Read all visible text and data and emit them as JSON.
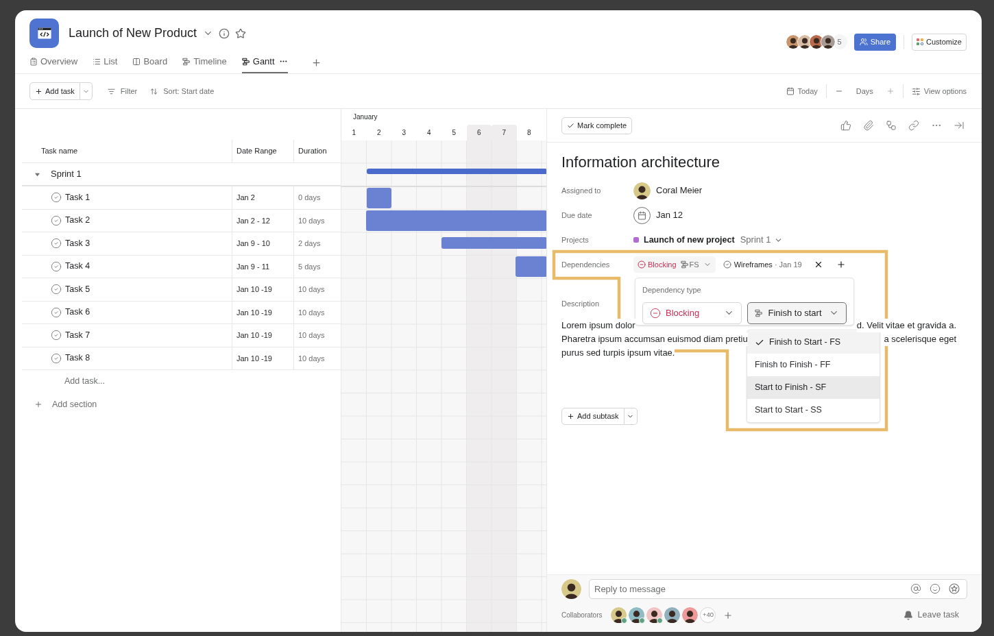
{
  "project": {
    "title": "Launch of New Product"
  },
  "tabs": [
    {
      "label": "Overview",
      "kind": "overview",
      "selected": false
    },
    {
      "label": "List",
      "kind": "list",
      "selected": false
    },
    {
      "label": "Board",
      "kind": "board",
      "selected": false
    },
    {
      "label": "Timeline",
      "kind": "timeline",
      "selected": false
    },
    {
      "label": "Gantt",
      "kind": "gantt",
      "selected": true
    }
  ],
  "members": {
    "count": "5"
  },
  "share": "Share",
  "customize": "Customize",
  "toolbar": {
    "add_task": "Add task",
    "filter": "Filter",
    "sort": "Sort: Start date",
    "today": "Today",
    "zoom": "Days",
    "view_options": "View options"
  },
  "gantt": {
    "month": "January",
    "days": [
      {
        "label": "1",
        "weekend": false
      },
      {
        "label": "2",
        "weekend": false
      },
      {
        "label": "3",
        "weekend": false
      },
      {
        "label": "4",
        "weekend": false
      },
      {
        "label": "5",
        "weekend": false
      },
      {
        "label": "6",
        "weekend": true
      },
      {
        "label": "7",
        "weekend": true
      },
      {
        "label": "8",
        "weekend": false
      }
    ]
  },
  "table": {
    "columns": [
      "Task name",
      "Date Range",
      "Duration"
    ],
    "section": {
      "name": "Sprint 1",
      "expanded": true
    },
    "rows": [
      {
        "name": "Task 1",
        "range": "Jan 2",
        "duration": "0 days",
        "completed": false
      },
      {
        "name": "Task 2",
        "range": "Jan 2 - 12",
        "duration": "10 days",
        "completed": false
      },
      {
        "name": "Task 3",
        "range": "Jan 9 - 10",
        "duration": "2 days",
        "completed": false
      },
      {
        "name": "Task 4",
        "range": "Jan 9 - 11",
        "duration": "5 days",
        "completed": false
      },
      {
        "name": "Task 5",
        "range": "Jan 10 -19",
        "duration": "10 days",
        "completed": false
      },
      {
        "name": "Task 6",
        "range": "Jan 10 -19",
        "duration": "10 days",
        "completed": false
      },
      {
        "name": "Task 7",
        "range": "Jan 10 -19",
        "duration": "10 days",
        "completed": false
      },
      {
        "name": "Task 8",
        "range": "Jan 10 -19",
        "duration": "10 days",
        "completed": false
      }
    ],
    "add_task": "Add task...",
    "add_section": "Add section"
  },
  "detail": {
    "mark_complete": "Mark complete",
    "title": "Information architecture",
    "assigned_label": "Assigned to",
    "assignee": "Coral Meier",
    "due_label": "Due date",
    "due": "Jan 12",
    "projects_label": "Projects",
    "project": {
      "name": "Launch of new project",
      "color": "#b36bd4",
      "section": "Sprint 1"
    },
    "dependencies_label": "Dependencies",
    "dependency": {
      "type": "Blocking",
      "code": "FS",
      "task": "Wireframes",
      "date": "· Jan 19"
    },
    "description_label": "Description",
    "description": [
      {
        "left": "Lorem ipsum dolor",
        "right": "d. Velit vitae et gravida a."
      },
      {
        "left": "Pharetra ipsum accumsan euismod diam pretiu",
        "right": "a scelerisque eget"
      },
      {
        "left": "purus sed turpis ipsum vitae."
      }
    ],
    "add_subtask": "Add subtask"
  },
  "popover": {
    "title": "Dependency type",
    "type": "Blocking",
    "mode": "Finish to start",
    "options": [
      {
        "label": "Finish to Start - FS",
        "selected": true,
        "highlighted": false
      },
      {
        "label": "Finish to Finish - FF",
        "selected": false,
        "highlighted": false
      },
      {
        "label": "Start to Finish - SF",
        "selected": false,
        "highlighted": true
      },
      {
        "label": "Start to Start - SS",
        "selected": false,
        "highlighted": false
      }
    ]
  },
  "reply": {
    "placeholder": "Reply to message"
  },
  "collaborators": {
    "label": "Collaborators",
    "more": "+40",
    "people": [
      {
        "online": true
      },
      {
        "online": true
      },
      {
        "online": true
      },
      {
        "online": false
      },
      {
        "online": false
      }
    ]
  },
  "leave": "Leave task"
}
